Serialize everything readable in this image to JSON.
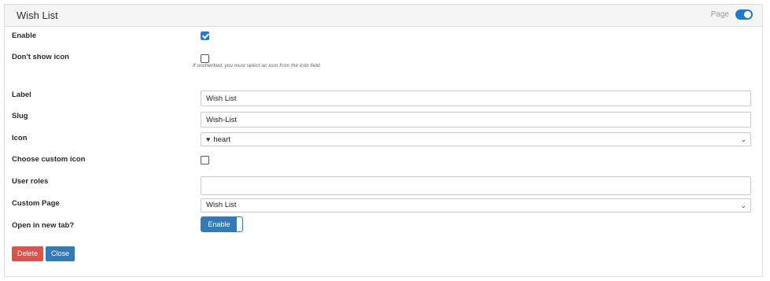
{
  "header": {
    "title": "Wish List",
    "page_label": "Page",
    "page_toggle_on": true
  },
  "form": {
    "enable": {
      "label": "Enable",
      "checked": true
    },
    "dont_show_icon": {
      "label": "Don't show icon",
      "checked": false,
      "hint": "If unchecked, you must select an icon from the icon field."
    },
    "label": {
      "label": "Label",
      "value": "Wish List"
    },
    "slug": {
      "label": "Slug",
      "value": "Wish-List"
    },
    "icon": {
      "label": "Icon",
      "value": "heart",
      "arrow": "⌄"
    },
    "choose_custom_icon": {
      "label": "Choose custom icon",
      "checked": false
    },
    "user_roles": {
      "label": "User roles",
      "value": ""
    },
    "custom_page": {
      "label": "Custom Page",
      "value": "Wish List",
      "arrow": "⌄"
    },
    "open_new_tab": {
      "label": "Open in new tab?",
      "button_label": "Enable"
    }
  },
  "footer": {
    "delete_label": "Delete",
    "close_label": "Close"
  },
  "colors": {
    "accent": "#337ab7",
    "danger": "#d9534f",
    "toggle": "#1f7ad0"
  }
}
